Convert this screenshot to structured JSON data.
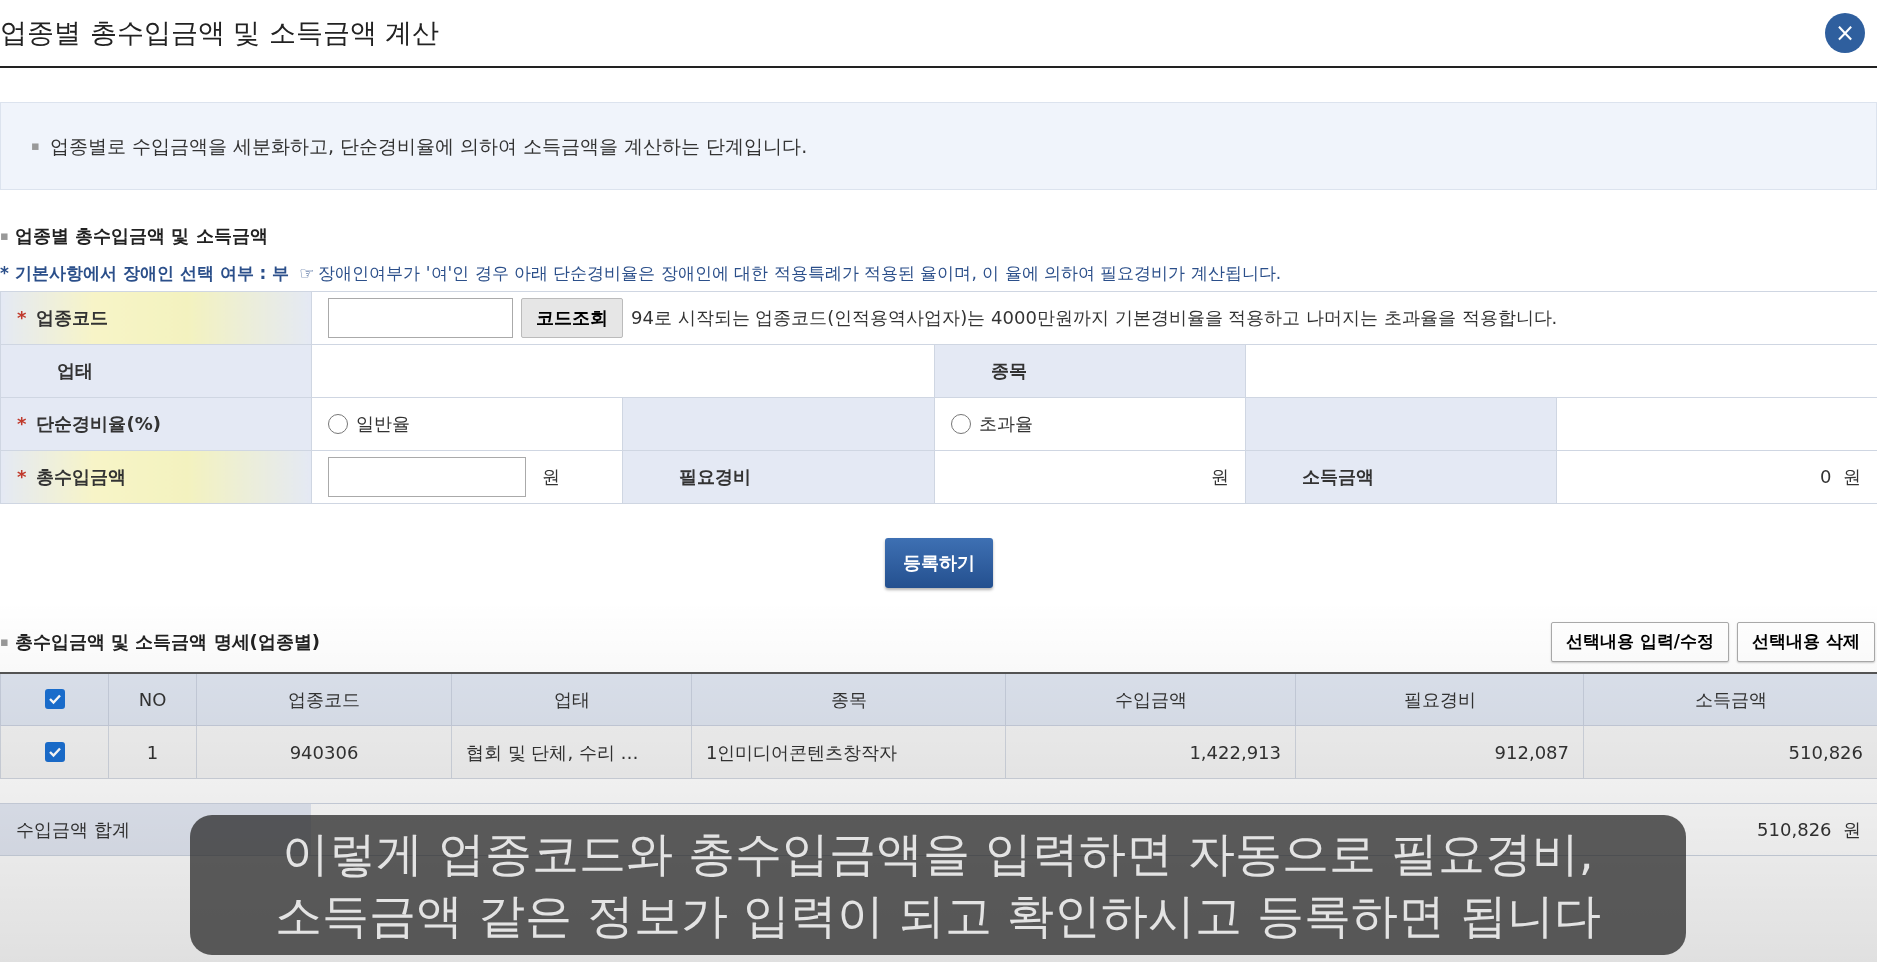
{
  "dialog": {
    "title": "업종별 총수입금액 및 소득금액 계산",
    "close": "×"
  },
  "info": {
    "bullet": "▪",
    "text": "업종별로 수입금액을 세분화하고, 단순경비율에 의하여 소득금액을 계산하는 단계입니다."
  },
  "section1": {
    "bullet": "▪",
    "title": "업종별 총수입금액 및 소득금액"
  },
  "notice": {
    "label": "* 기본사항에서 장애인 선택 여부 : 부",
    "icon": "☞",
    "text": "장애인여부가 '여'인 경우 아래 단순경비율은 장애인에 대한 적용특례가 적용된 율이며, 이 율에 의하여 필요경비가 계산됩니다."
  },
  "form": {
    "rows": [
      {
        "cells": [
          {
            "kind": "label",
            "text": "업종코드",
            "mark": "*",
            "highlighted": true
          },
          {
            "kind": "code",
            "colspan": 5,
            "button": "코드조회",
            "hint": "94로 시작되는 업종코드(인적용역사업자)는 4000만원까지 기본경비율을 적용하고 나머지는 초과율을 적용합니다."
          }
        ]
      },
      {
        "cells": [
          {
            "kind": "label",
            "text": "업태",
            "highlighted": false
          },
          {
            "kind": "empty",
            "colspan": 2
          },
          {
            "kind": "label",
            "text": "종목",
            "highlighted": false
          },
          {
            "kind": "empty",
            "colspan": 2
          }
        ]
      },
      {
        "cells": [
          {
            "kind": "label",
            "text": "단순경비율(%)",
            "mark": "*",
            "highlighted": false
          },
          {
            "kind": "radio",
            "text": "일반율",
            "selected": false
          },
          {
            "kind": "shaded"
          },
          {
            "kind": "radio",
            "text": "초과율",
            "selected": false
          },
          {
            "kind": "shaded"
          },
          {
            "kind": "empty"
          }
        ]
      },
      {
        "cells": [
          {
            "kind": "label",
            "text": "총수입금액",
            "mark": "*",
            "highlighted": true
          },
          {
            "kind": "input",
            "unit": "원"
          },
          {
            "kind": "label",
            "text": "필요경비",
            "highlighted": false
          },
          {
            "kind": "value",
            "text": "원"
          },
          {
            "kind": "label",
            "text": "소득금액",
            "highlighted": false
          },
          {
            "kind": "value",
            "text": "0  원"
          }
        ]
      }
    ]
  },
  "register_button": "등록하기",
  "section2": {
    "bullet": "▪",
    "title": "총수입금액 및 소득금액 명세(업종별)",
    "buttons": [
      "선택내용 입력/수정",
      "선택내용 삭제"
    ]
  },
  "table": {
    "header_checked": true,
    "columns": [
      "NO",
      "업종코드",
      "업태",
      "종목",
      "수입금액",
      "필요경비",
      "소득금액"
    ],
    "rows": [
      {
        "checked": true,
        "cells": [
          "1",
          "940306",
          "협회 및 단체, 수리 …",
          "1인미디어콘텐츠창작자",
          "1,422,913",
          "912,087",
          "510,826"
        ]
      }
    ]
  },
  "totals": {
    "label": "수입금액 합계",
    "income_total": "510,826  원"
  },
  "caption": {
    "lines": [
      "이렇게 업종코드와 총수입금액을 입력하면 자동으로 필요경비,",
      "소득금액 같은 정보가 입력이 되고 확인하시고 등록하면 됩니다"
    ]
  }
}
